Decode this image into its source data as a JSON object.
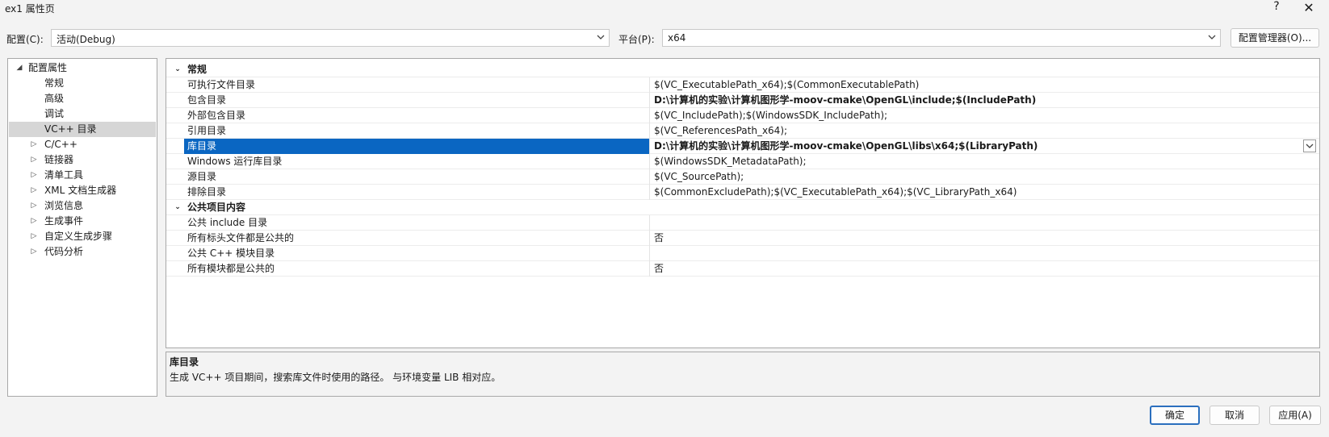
{
  "window": {
    "title": "ex1 属性页",
    "help": "?",
    "close": "✕"
  },
  "config_bar": {
    "config_label": "配置(C):",
    "config_value": "活动(Debug)",
    "platform_label": "平台(P):",
    "platform_value": "x64",
    "manager_button": "配置管理器(O)..."
  },
  "tree": {
    "items": [
      {
        "label": "配置属性",
        "twisty": "◢"
      },
      {
        "label": "常规"
      },
      {
        "label": "高级"
      },
      {
        "label": "调试"
      },
      {
        "label": "VC++ 目录"
      },
      {
        "label": "C/C++",
        "twisty": "▷"
      },
      {
        "label": "链接器",
        "twisty": "▷"
      },
      {
        "label": "清单工具",
        "twisty": "▷"
      },
      {
        "label": "XML 文档生成器",
        "twisty": "▷"
      },
      {
        "label": "浏览信息",
        "twisty": "▷"
      },
      {
        "label": "生成事件",
        "twisty": "▷"
      },
      {
        "label": "自定义生成步骤",
        "twisty": "▷"
      },
      {
        "label": "代码分析",
        "twisty": "▷"
      }
    ]
  },
  "grid": {
    "cat1": {
      "name": "常规",
      "twisty": "⌄"
    },
    "rows1": [
      {
        "name": "可执行文件目录",
        "value": "$(VC_ExecutablePath_x64);$(CommonExecutablePath)"
      },
      {
        "name": "包含目录",
        "value": "D:\\计算机的实验\\计算机图形学-moov-cmake\\OpenGL\\include;$(IncludePath)"
      },
      {
        "name": "外部包含目录",
        "value": "$(VC_IncludePath);$(WindowsSDK_IncludePath);"
      },
      {
        "name": "引用目录",
        "value": "$(VC_ReferencesPath_x64);"
      },
      {
        "name": "库目录",
        "value": "D:\\计算机的实验\\计算机图形学-moov-cmake\\OpenGL\\libs\\x64;$(LibraryPath)"
      },
      {
        "name": "Windows 运行库目录",
        "value": "$(WindowsSDK_MetadataPath);"
      },
      {
        "name": "源目录",
        "value": "$(VC_SourcePath);"
      },
      {
        "name": "排除目录",
        "value": "$(CommonExcludePath);$(VC_ExecutablePath_x64);$(VC_LibraryPath_x64)"
      }
    ],
    "cat2": {
      "name": "公共项目内容",
      "twisty": "⌄"
    },
    "rows2": [
      {
        "name": "公共 include 目录",
        "value": ""
      },
      {
        "name": "所有标头文件都是公共的",
        "value": "否"
      },
      {
        "name": "公共 C++ 模块目录",
        "value": ""
      },
      {
        "name": "所有模块都是公共的",
        "value": "否"
      }
    ]
  },
  "description": {
    "title": "库目录",
    "text": "生成 VC++ 项目期间，搜索库文件时使用的路径。 与环境变量 LIB 相对应。"
  },
  "buttons": {
    "ok": "确定",
    "cancel": "取消",
    "apply": "应用(A)"
  }
}
